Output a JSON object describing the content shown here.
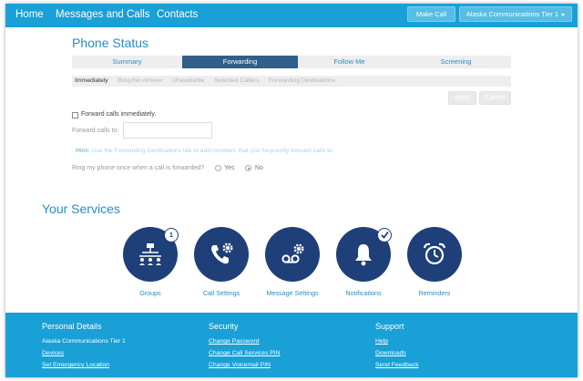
{
  "nav": {
    "home": "Home",
    "messages_and_calls": "Messages and Calls",
    "contacts": "Contacts",
    "make_call": "Make Call",
    "account": "Alaska Communications Tier 1"
  },
  "phone_status": {
    "title": "Phone Status",
    "tabs": [
      "Summary",
      "Forwarding",
      "Follow Me",
      "Screening"
    ],
    "active_tab": "Forwarding",
    "subtabs": [
      "Immediately",
      "Busy/No Answer",
      "Unavailable",
      "Selected Callers",
      "Forwarding Destinations"
    ],
    "active_subtab": "Immediately",
    "apply_label": "Apply",
    "cancel_label": "Cancel",
    "forward_immediately_label": "Forward calls immediately.",
    "forward_immediately_checked": false,
    "forward_to_label": "Forward calls to:",
    "forward_to_value": "",
    "hint_prefix": "Hint:",
    "hint_text": "Use the Forwarding Destinations tab to add numbers that you frequently forward calls to.",
    "ring_label": "Ring my phone once when a call is forwarded?",
    "ring_yes": "Yes",
    "ring_no": "No",
    "ring_selected": "No"
  },
  "services": {
    "title": "Your Services",
    "items": [
      {
        "label": "Groups",
        "icon": "groups-icon",
        "badge": "1"
      },
      {
        "label": "Call Settings",
        "icon": "phone-gear-icon"
      },
      {
        "label": "Message Settings",
        "icon": "voicemail-gear-icon"
      },
      {
        "label": "Notifications",
        "icon": "bell-icon",
        "badge_icon": "check-icon"
      },
      {
        "label": "Reminders",
        "icon": "alarm-clock-icon"
      }
    ]
  },
  "footer": {
    "personal": {
      "heading": "Personal Details",
      "account_name": "Alaska Communications Tier 1",
      "devices": "Devices",
      "emergency": "Set Emergency Location"
    },
    "security": {
      "heading": "Security",
      "change_password": "Change Password",
      "change_pin": "Change Call Services PIN",
      "change_voicemail_pin": "Change Voicemail PIN"
    },
    "support": {
      "heading": "Support",
      "help": "Help",
      "downloads": "Downloads",
      "feedback": "Send Feedback"
    }
  },
  "colors": {
    "brand_blue": "#19a0d6",
    "navy": "#1f3f78",
    "link_blue": "#2a8cc4",
    "active_tab": "#2f5f8a"
  }
}
